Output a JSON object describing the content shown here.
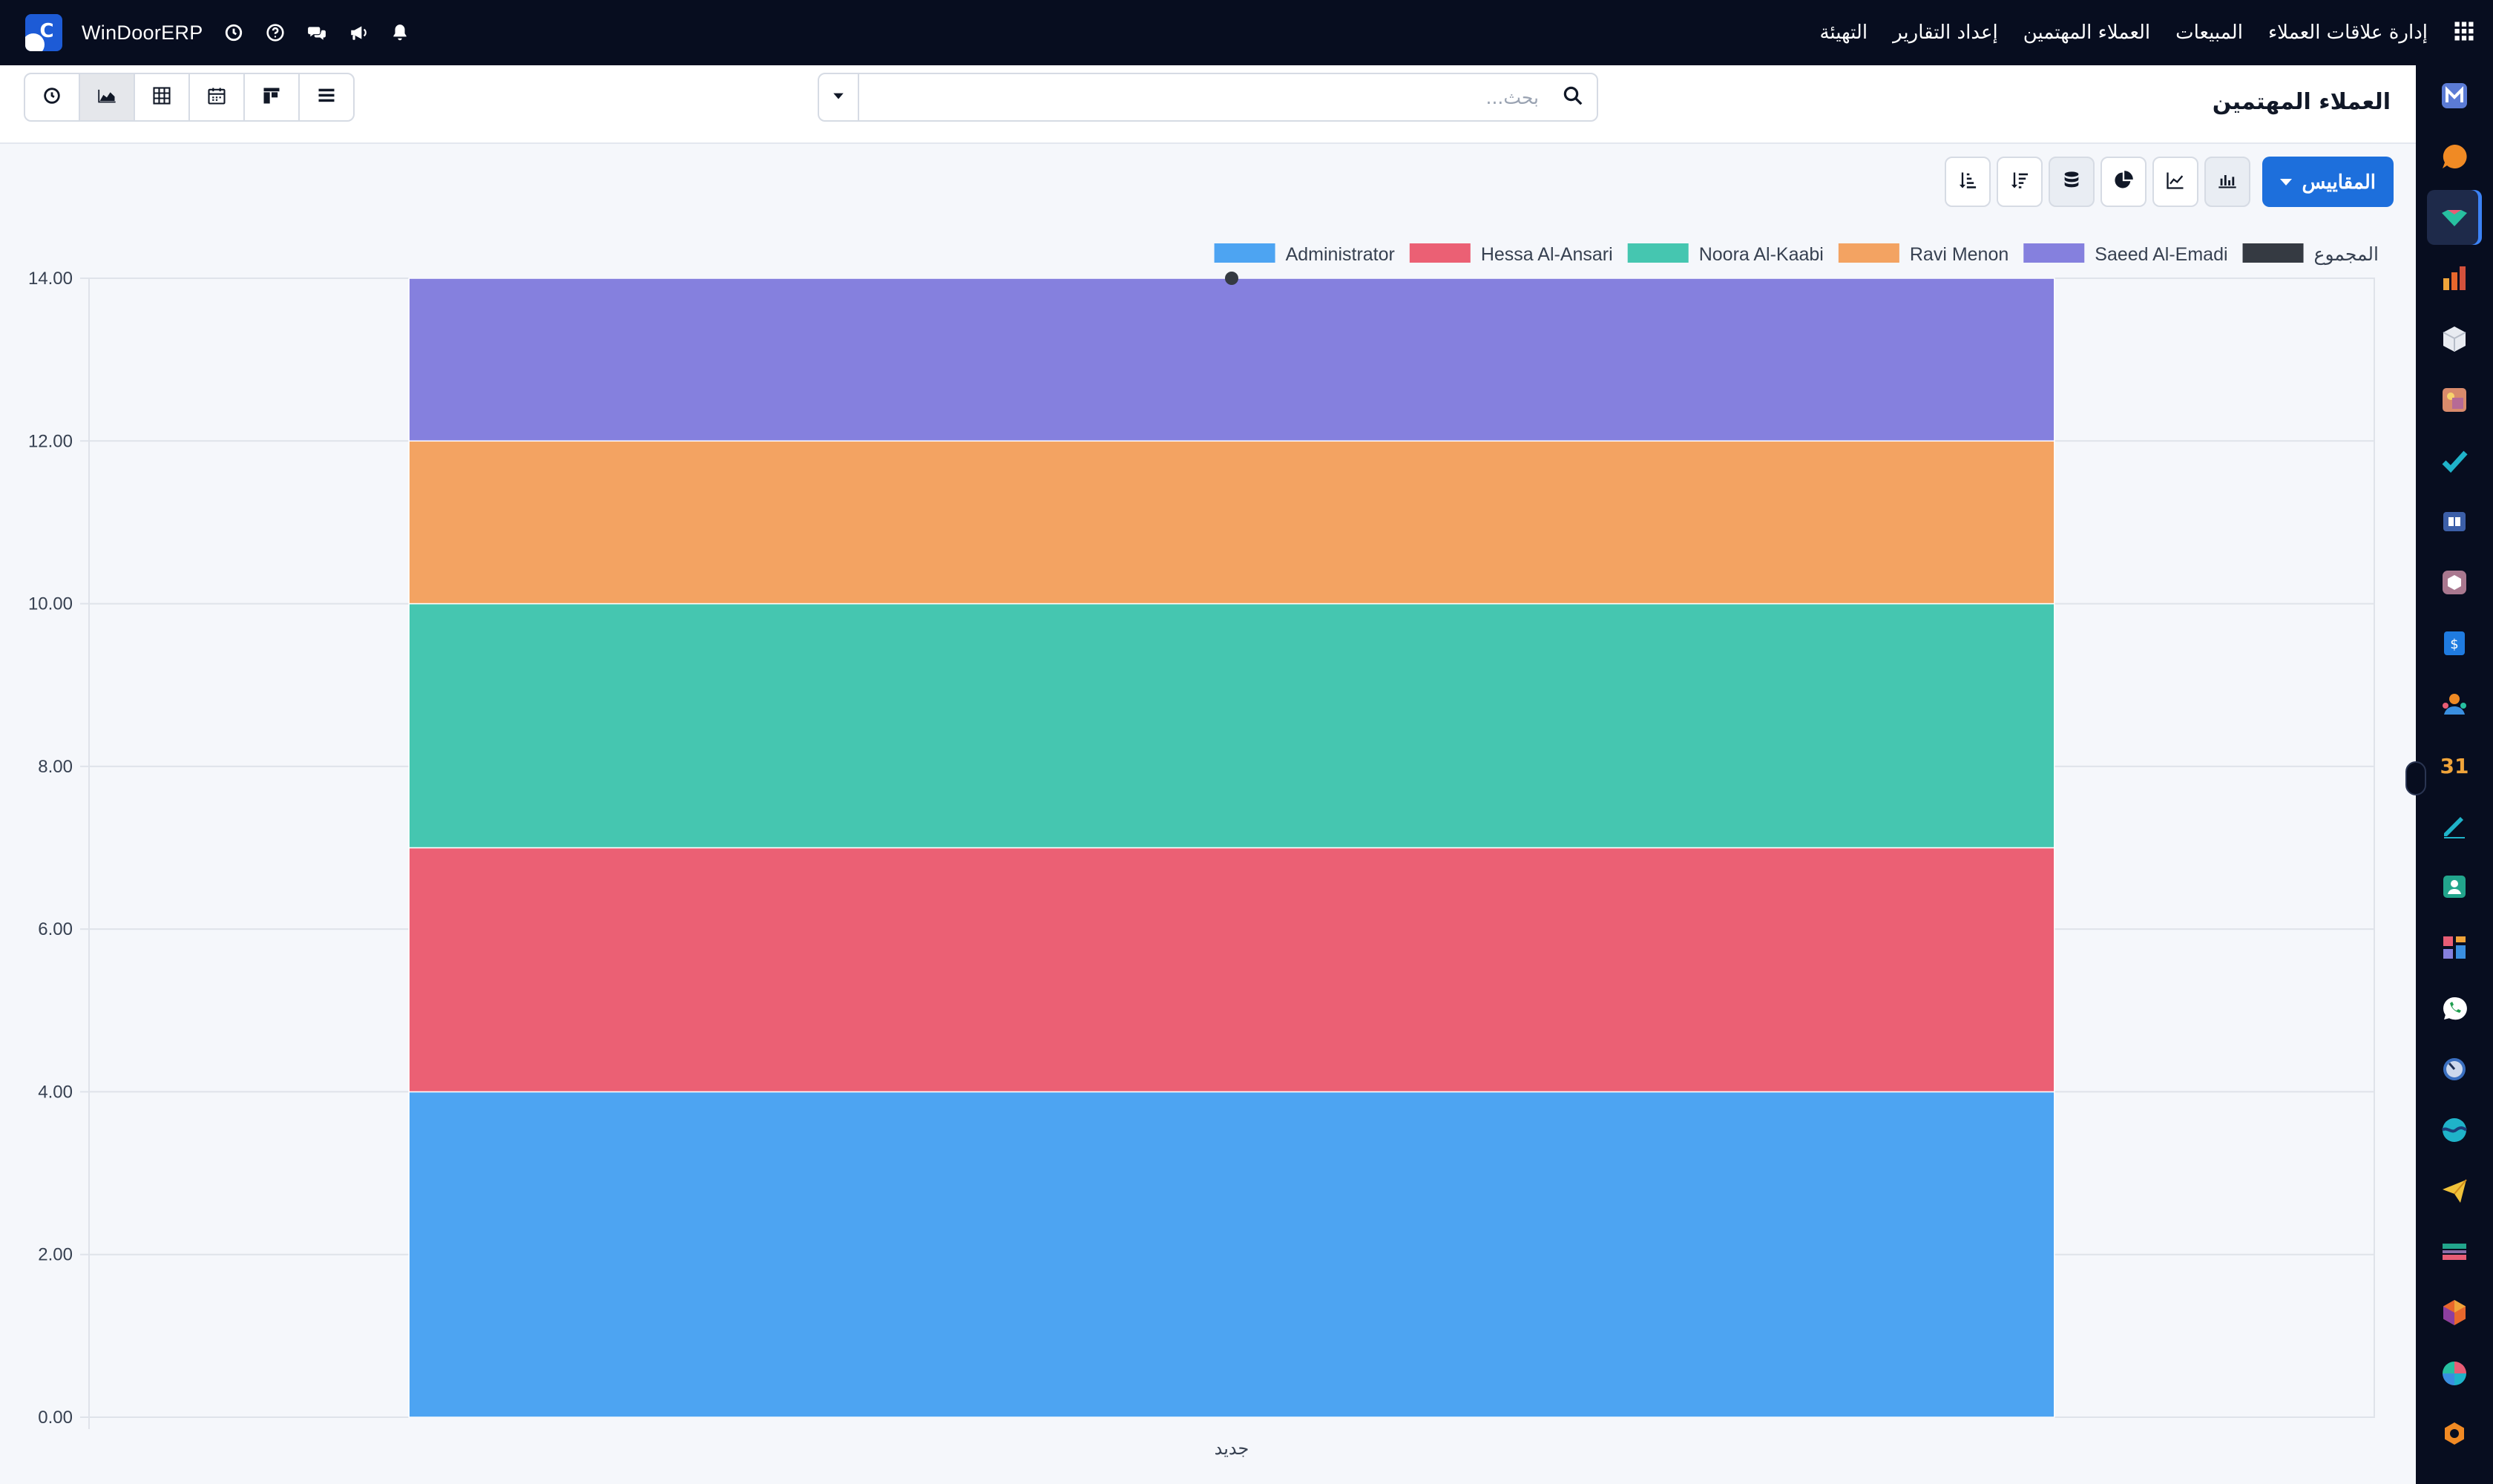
{
  "topbar": {
    "brand_letter": "C",
    "brand_name": "WinDoorERP",
    "menu": [
      "إدارة علاقات العملاء",
      "المبيعات",
      "العملاء المهتمين",
      "إعداد التقارير",
      "التهيئة"
    ],
    "icons": [
      "clock-icon",
      "help-icon",
      "chat-icon",
      "megaphone-icon",
      "bell-icon",
      "apps-grid-icon"
    ]
  },
  "control": {
    "title": "العملاء المهتمين",
    "search_placeholder": "بحث..."
  },
  "toolbar": {
    "measures_label": "المقاييس"
  },
  "sidebar_apps": [
    "m-app-icon",
    "chat-bubble-app-icon",
    "crm-app-icon",
    "reports-app-icon",
    "inventory-box-icon",
    "photo-app-icon",
    "check-app-icon",
    "book-app-icon",
    "package-app-icon",
    "invoice-app-icon",
    "employees-app-icon",
    "calendar-app-icon",
    "sign-app-icon",
    "contacts-app-icon",
    "dashboard-app-icon",
    "whatsapp-icon",
    "clock-app-icon",
    "wave-app-icon",
    "send-app-icon",
    "card-app-icon",
    "hexagon-app-icon",
    "pie-app-icon",
    "settings-app-icon"
  ],
  "chart_data": {
    "type": "bar",
    "stacked": true,
    "categories": [
      "جديد"
    ],
    "series": [
      {
        "name": "Administrator",
        "values": [
          4
        ],
        "color": "#4da4f2"
      },
      {
        "name": "Hessa Al-Ansari",
        "values": [
          3
        ],
        "color": "#eb6074"
      },
      {
        "name": "Noora Al-Kaabi",
        "values": [
          3
        ],
        "color": "#45c6b0"
      },
      {
        "name": "Ravi Menon",
        "values": [
          2
        ],
        "color": "#f3a362"
      },
      {
        "name": "Saeed Al-Emadi",
        "values": [
          2
        ],
        "color": "#8580de"
      }
    ],
    "total": {
      "name": "المجموع",
      "values": [
        14
      ],
      "color": "#353a42"
    },
    "ylim": [
      0,
      14
    ],
    "yticks": [
      "0.00",
      "2.00",
      "4.00",
      "6.00",
      "8.00",
      "10.00",
      "12.00",
      "14.00"
    ],
    "grid": true,
    "legend": "top-right"
  }
}
